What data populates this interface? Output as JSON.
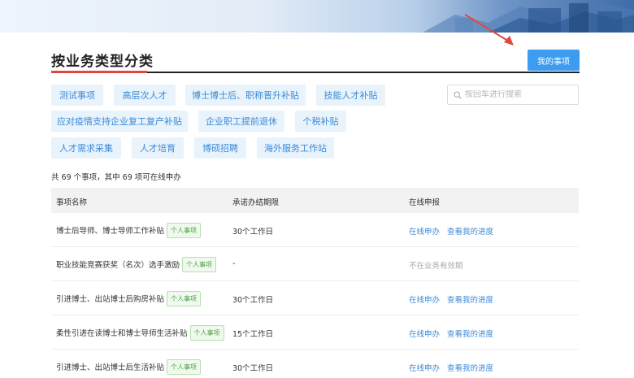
{
  "page": {
    "title": "按业务类型分类",
    "my_items_button": "我的事项",
    "search_placeholder": "按回车进行搜索",
    "summary": "共 69 个事项，其中 69 项可在线申办"
  },
  "categories": [
    "测试事项",
    "高层次人才",
    "博士博士后、职称晋升补贴",
    "技能人才补贴",
    "应对疫情支持企业复工复产补贴",
    "企业职工提前退休",
    "个税补贴",
    "人才需求采集",
    "人才培育",
    "博硕招聘",
    "海外服务工作站"
  ],
  "table": {
    "headers": [
      "事项名称",
      "承诺办结期限",
      "在线申报"
    ],
    "rows": [
      {
        "name": "博士后导师、博士导师工作补贴",
        "badge": "个人事项",
        "deadline": "30个工作日",
        "apply": "在线申办",
        "progress": "查看我的进度",
        "status": ""
      },
      {
        "name": "职业技能竞赛获奖（名次）选手激励",
        "badge": "个人事项",
        "deadline": "-",
        "apply": "",
        "progress": "",
        "status": "不在业务有效期"
      },
      {
        "name": "引进博士、出站博士后购房补贴",
        "badge": "个人事项",
        "deadline": "30个工作日",
        "apply": "在线申办",
        "progress": "查看我的进度",
        "status": ""
      },
      {
        "name": "柔性引进在读博士和博士导师生活补贴",
        "badge": "个人事项",
        "deadline": "15个工作日",
        "apply": "在线申办",
        "progress": "查看我的进度",
        "status": ""
      },
      {
        "name": "引进博士、出站博士后生活补贴",
        "badge": "个人事项",
        "deadline": "30个工作日",
        "apply": "在线申办",
        "progress": "查看我的进度",
        "status": ""
      }
    ]
  },
  "colors": {
    "accent": "#3d9cf0",
    "link": "#3c8ad7",
    "title_underline": "#e2483d",
    "badge": "#4aa03f",
    "arrow": "#e2483d"
  }
}
